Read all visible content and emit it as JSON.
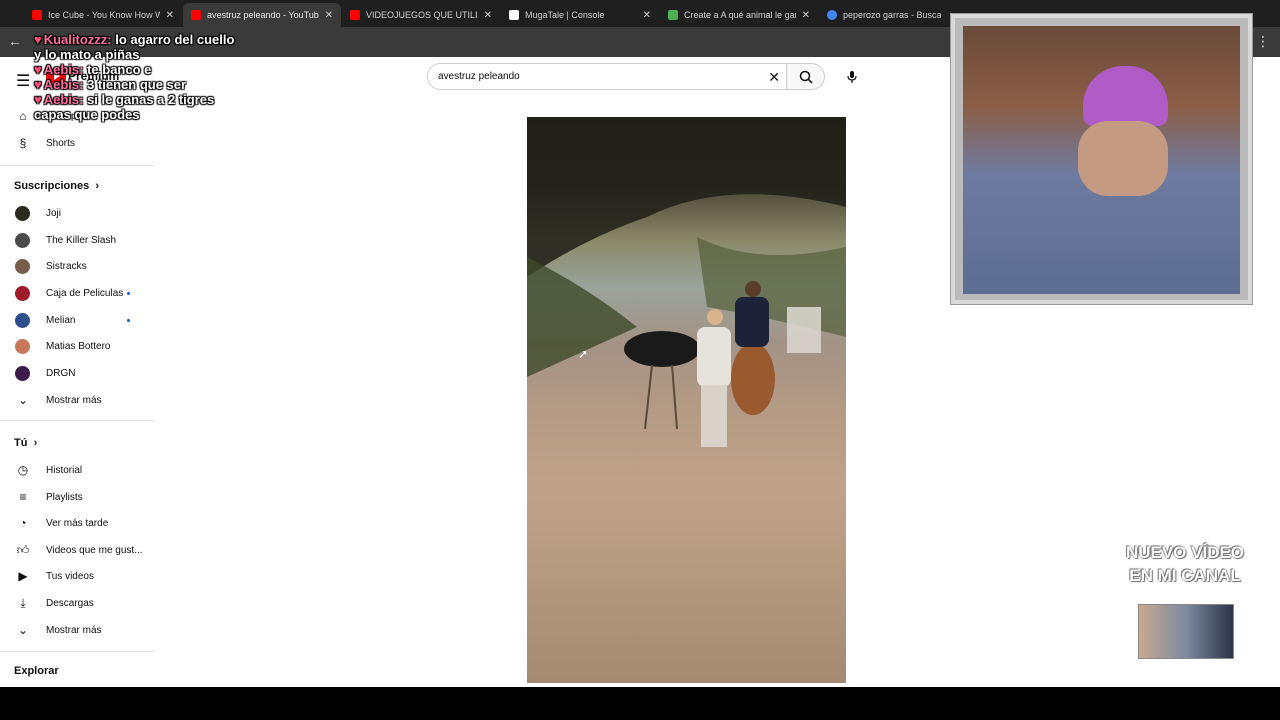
{
  "browser": {
    "tabs": [
      {
        "title": "Ice Cube - You Know How We Do",
        "favicon_color": "#ff0000",
        "active": false
      },
      {
        "title": "avestruz peleando - YouTube",
        "favicon_color": "#ff0000",
        "active": true
      },
      {
        "title": "VIDEOJUEGOS QUE UTILIZARON",
        "favicon_color": "#ff0000",
        "active": false
      },
      {
        "title": "MugaTale | Console",
        "favicon_color": "#ffffff",
        "active": false
      },
      {
        "title": "Create a A qué animal le ganarías",
        "favicon_color": "#4caf50",
        "active": false
      },
      {
        "title": "peperozo garras - Buscar con Google",
        "favicon_color": "#4285f4",
        "active": false
      }
    ]
  },
  "youtube": {
    "logo_text": "Premium",
    "search": {
      "query": "avestruz peleando"
    },
    "nav": {
      "home": "Principal",
      "shorts": "Shorts"
    },
    "subscriptions": {
      "heading": "Suscripciones",
      "channels": [
        {
          "name": "Joji",
          "avatar_color": "#2a2a1e",
          "new": false
        },
        {
          "name": "The Killer Slash",
          "avatar_color": "#4b4b4b",
          "new": false
        },
        {
          "name": "Sistracks",
          "avatar_color": "#7a5c4a",
          "new": false
        },
        {
          "name": "Caja de Peliculas",
          "avatar_color": "#a01b2a",
          "new": true
        },
        {
          "name": "Melian",
          "avatar_color": "#2d4f8c",
          "new": true
        },
        {
          "name": "Matias Bottero",
          "avatar_color": "#c7785a",
          "new": false
        },
        {
          "name": "DRGN",
          "avatar_color": "#3a1a4a",
          "new": false
        }
      ],
      "show_more": "Mostrar más"
    },
    "you": {
      "heading": "Tú",
      "items": [
        "Historial",
        "Playlists",
        "Ver más tarde",
        "Videos que me gust...",
        "Tus videos",
        "Descargas",
        "Mostrar más"
      ]
    },
    "explore_heading": "Explorar"
  },
  "overlay": {
    "chat": [
      {
        "nick": "Kualitozzz:",
        "text": "lo agarro del cuello"
      },
      {
        "nick": "",
        "text": "y lo mato a piñas"
      },
      {
        "nick": "Aebis:",
        "text": "te banco e"
      },
      {
        "nick": "Aebis:",
        "text": "3 tienen que ser"
      },
      {
        "nick": "Aebis:",
        "text": "si le ganas a 2 tigres"
      },
      {
        "nick": "",
        "text": "capas que podes"
      }
    ],
    "promo_line1": "NUEVO VÍDEO",
    "promo_line2": "EN MI CANAL"
  }
}
